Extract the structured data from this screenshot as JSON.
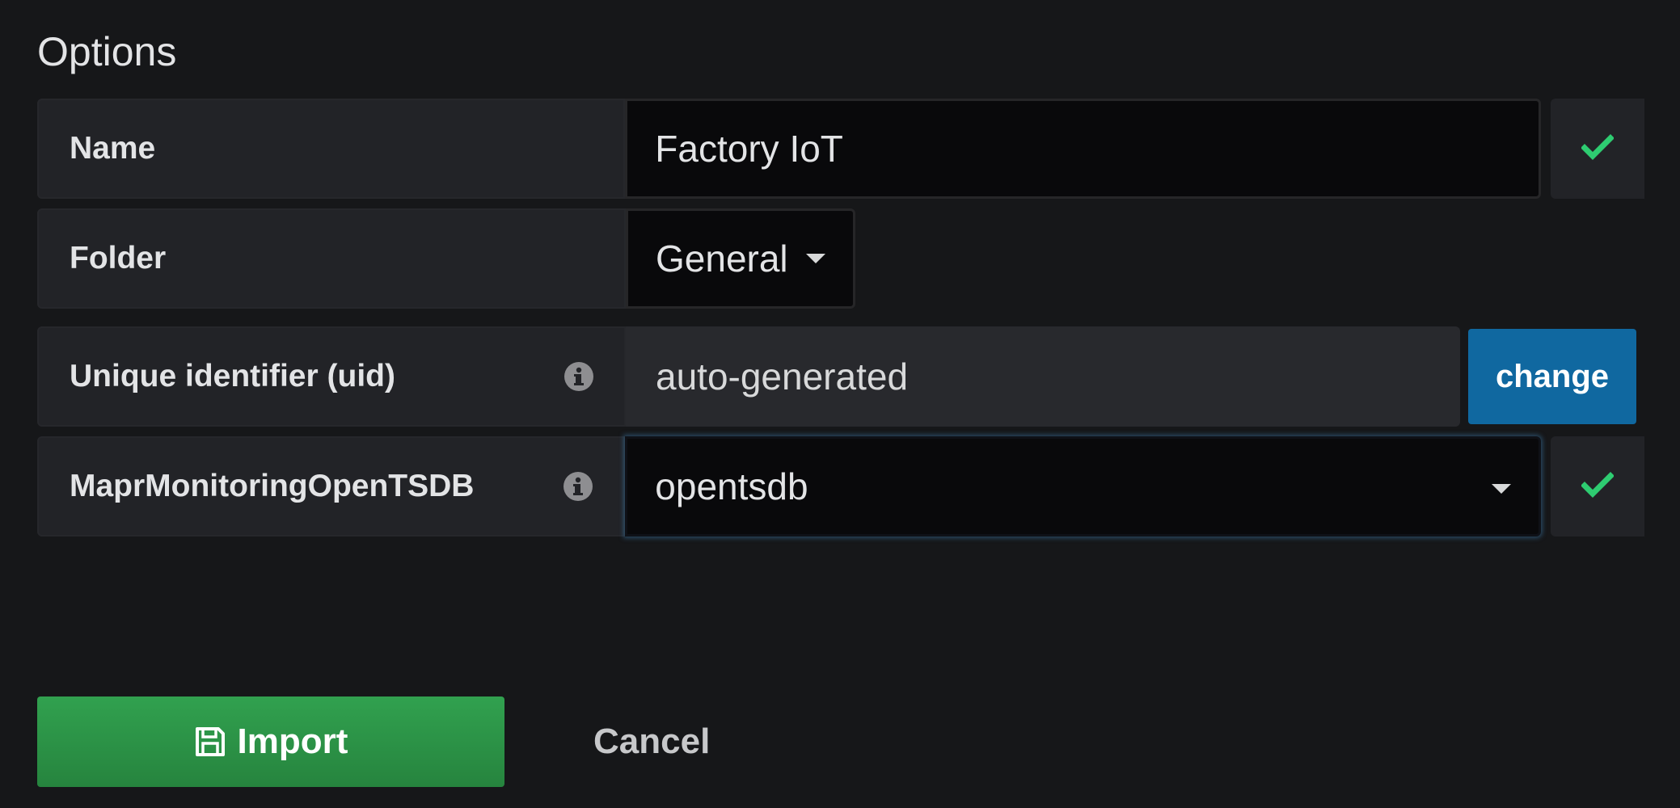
{
  "options": {
    "title": "Options"
  },
  "fields": {
    "name": {
      "label": "Name",
      "value": "Factory IoT",
      "status": "valid"
    },
    "folder": {
      "label": "Folder",
      "value": "General"
    },
    "uid": {
      "label": "Unique identifier (uid)",
      "value": "auto-generated",
      "change_label": "change"
    },
    "datasource": {
      "label": "MaprMonitoringOpenTSDB",
      "value": "opentsdb",
      "status": "valid"
    }
  },
  "actions": {
    "import_label": "Import",
    "cancel_label": "Cancel"
  },
  "colors": {
    "background": "#161719",
    "primary_button": "#2d9a4a",
    "change_button": "#1068a0",
    "valid_check": "#2ecc71"
  },
  "icons": {
    "valid": "check-icon",
    "info": "info-icon",
    "dropdown": "caret-down-icon",
    "save": "floppy-disk-icon"
  }
}
